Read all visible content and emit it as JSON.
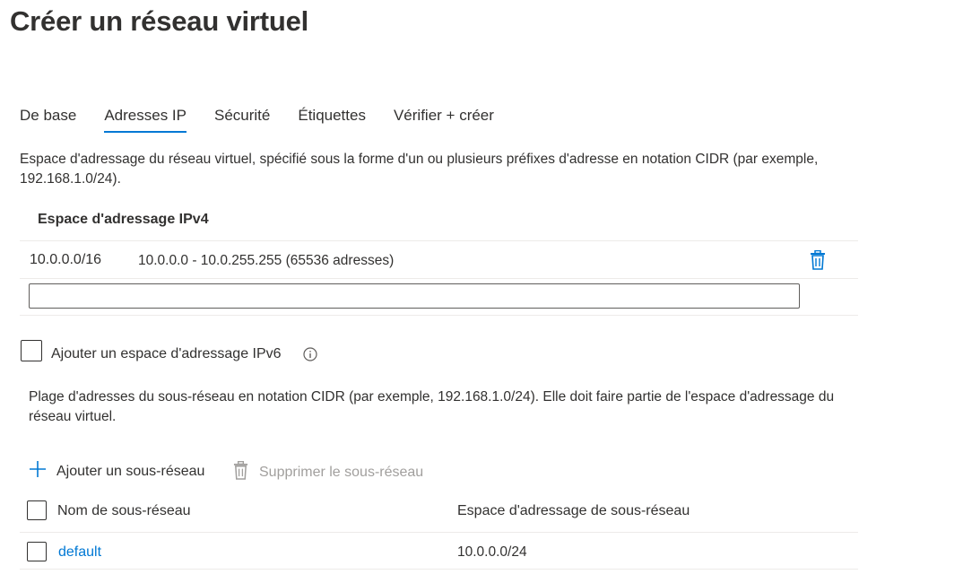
{
  "page": {
    "title": "Créer un réseau virtuel"
  },
  "tabs": [
    {
      "label": "De base"
    },
    {
      "label": "Adresses IP"
    },
    {
      "label": "Sécurité"
    },
    {
      "label": "Étiquettes"
    },
    {
      "label": "Vérifier + créer"
    }
  ],
  "active_tab": "Adresses IP",
  "address_space": {
    "description": "Espace d'adressage du réseau virtuel, spécifié sous la forme d'un ou plusieurs préfixes d'adresse en notation CIDR (par exemple, 192.168.1.0/24).",
    "column_header": "Espace d'adressage IPv4",
    "rows": [
      {
        "prefix": "10.0.0.0/16",
        "range": "10.0.0.0 - 10.0.255.255 (65536 adresses)",
        "delete_icon": "trash-icon"
      }
    ],
    "new_prefix_value": ""
  },
  "ipv6": {
    "label": "Ajouter un espace d'adressage IPv6",
    "checked": false,
    "info_icon": "info-icon"
  },
  "subnets": {
    "description": "Plage d'adresses du sous-réseau en notation CIDR (par exemple, 192.168.1.0/24). Elle doit faire partie de l'espace d'adressage du réseau virtuel.",
    "add_label": "Ajouter un sous-réseau",
    "delete_label": "Supprimer le sous-réseau",
    "columns": {
      "name": "Nom de sous-réseau",
      "address": "Espace d'adressage de sous-réseau"
    },
    "rows": [
      {
        "name": "default",
        "address": "10.0.0.0/24",
        "checked": false
      }
    ]
  },
  "colors": {
    "accent": "#0078d4",
    "text": "#323130",
    "disabled": "#a19f9d",
    "divider": "#edebe9"
  }
}
